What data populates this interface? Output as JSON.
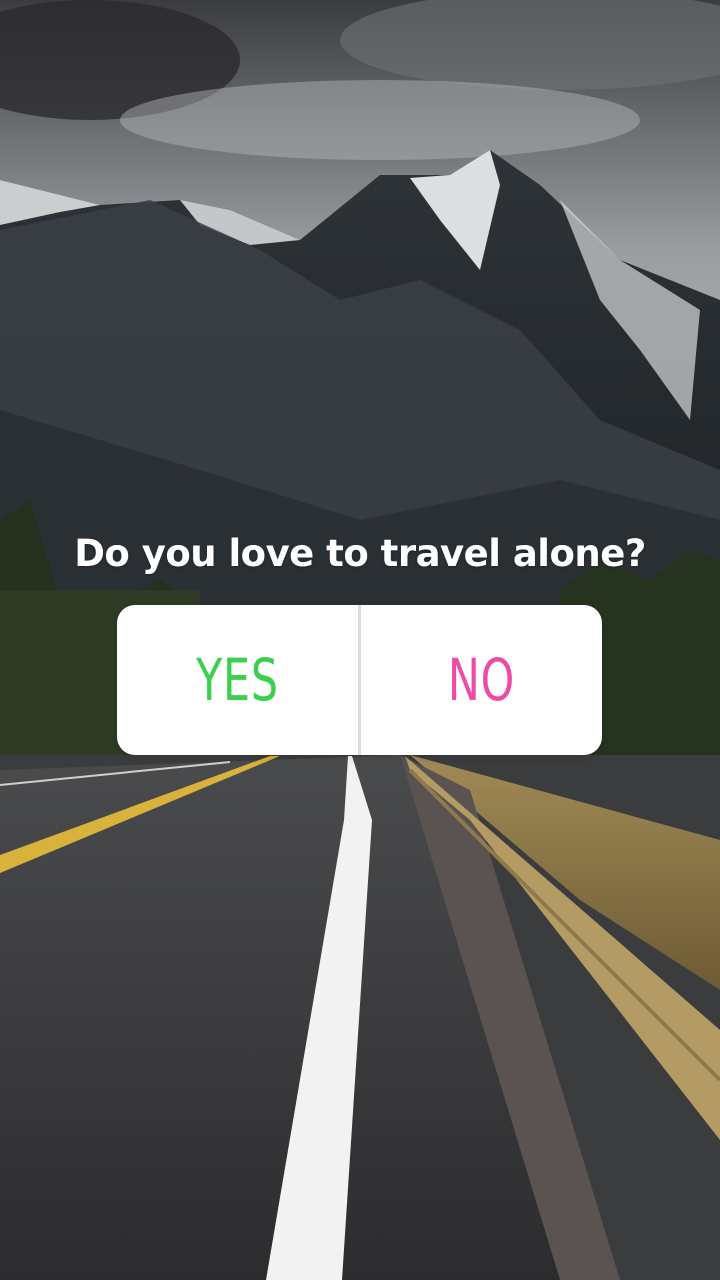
{
  "story": {
    "question": "Do you love to travel alone?",
    "poll": {
      "options": [
        {
          "label": "YES",
          "color": "#3ccf4e"
        },
        {
          "label": "NO",
          "color": "#ef4ba6"
        }
      ]
    }
  }
}
